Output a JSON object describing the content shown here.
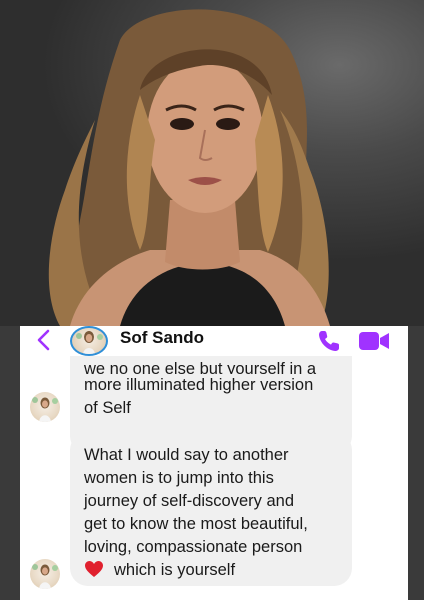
{
  "chat": {
    "contact_name": "Sof Sando",
    "messages": [
      {
        "lines": [
          "we no one else but yourself in a",
          "more illuminated higher version",
          "of Self"
        ]
      },
      {
        "lines": [
          "What I would say to another",
          "women is to jump into this",
          "journey of self-discovery and",
          "get to know the most beautiful,",
          "loving, compassionate person",
          "which is yourself"
        ],
        "emoji": "heart-emoji"
      }
    ]
  },
  "icons": {
    "back": "chevron-left-icon",
    "phone": "phone-icon",
    "video": "video-camera-icon"
  },
  "colors": {
    "accent": "#a033ff",
    "avatar_ring": "#2f8fd8",
    "bubble": "#f0f0f0",
    "heart": "#e0202e"
  }
}
